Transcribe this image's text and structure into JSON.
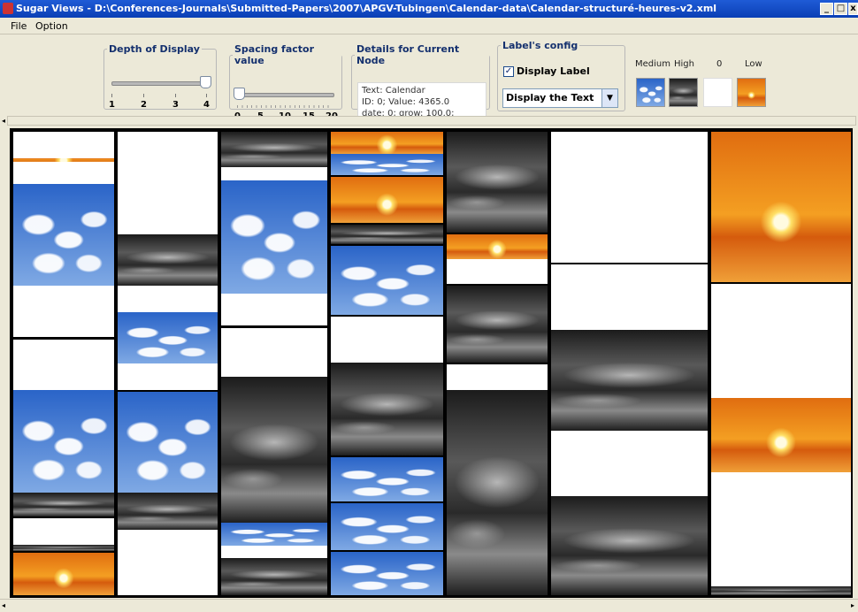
{
  "window": {
    "title": "Sugar Views - D:\\Conferences-Journals\\Submitted-Papers\\2007\\APGV-Tubingen\\Calendar-data\\Calendar-structuré-heures-v2.xml",
    "minimize": "_",
    "maximize": "□",
    "close": "x"
  },
  "menu": {
    "items": [
      {
        "label": "File"
      },
      {
        "label": "Option"
      }
    ]
  },
  "depth": {
    "legend": "Depth of Display",
    "ticks": [
      "1",
      "2",
      "3",
      "4"
    ],
    "min": 1,
    "max": 4,
    "value": 4
  },
  "spacing": {
    "legend": "Spacing factor value",
    "ticks": [
      "0",
      "5",
      "10",
      "15",
      "20"
    ],
    "min": 0,
    "max": 20,
    "value": 0
  },
  "details": {
    "legend": "Details for Current Node",
    "line1": "Text: Calendar",
    "line2": "ID: 0; Value: 4365.0",
    "line3": "date: 0; grow: 100.0;"
  },
  "label_config": {
    "legend": "Label's config",
    "checkbox_label": "Display Label",
    "checked": true,
    "combo_value": "Display the Text"
  },
  "color_legend": {
    "labels": [
      "Medium",
      "High",
      "0",
      "Low"
    ]
  },
  "colors": {
    "title_bar": "#0a3fb5",
    "toolbar_bg": "#ece9d8",
    "legend_text": "#14306e"
  }
}
